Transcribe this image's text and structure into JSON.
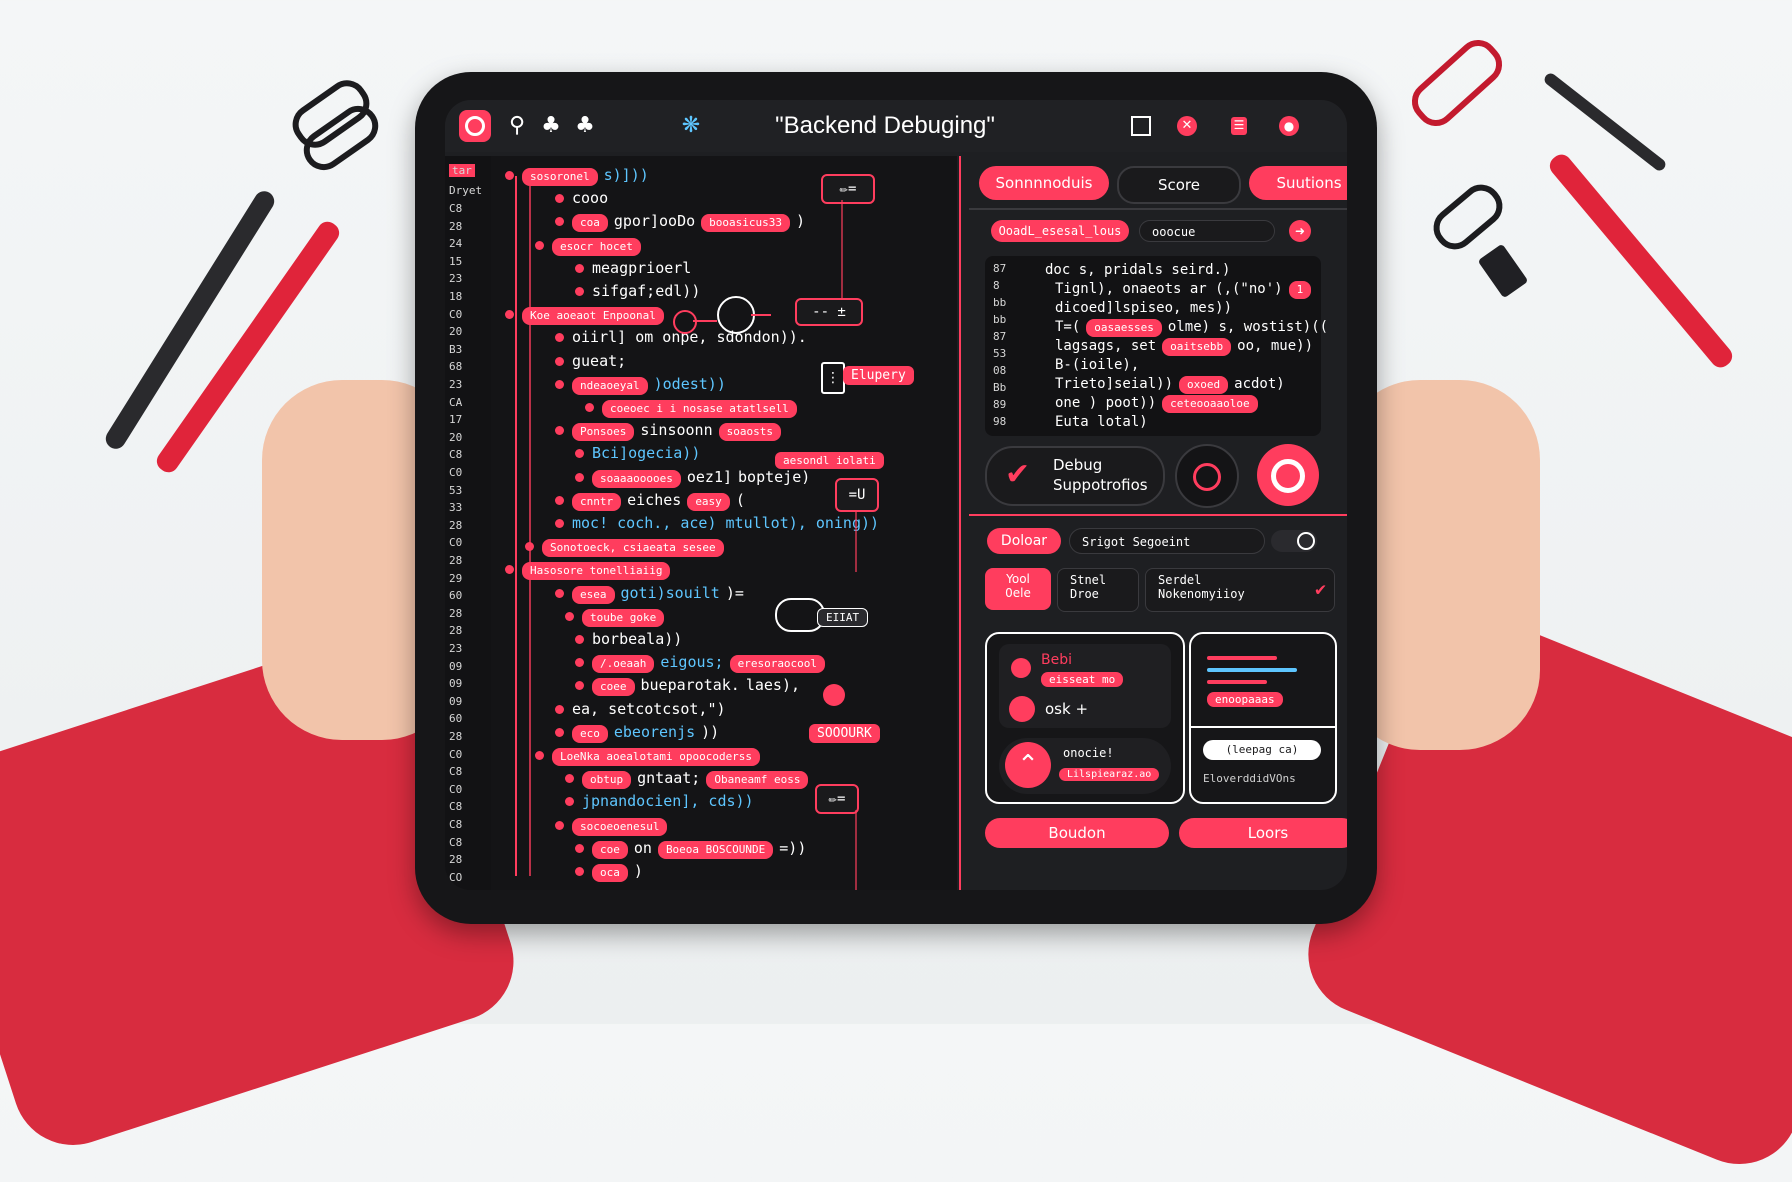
{
  "window": {
    "title": "\"Backend Debuging\""
  },
  "topbar": {
    "icons": [
      "record-icon",
      "search-icon",
      "club-icon",
      "plugin-icon",
      "bug-icon",
      "square-icon",
      "close-circle-icon",
      "menu-icon",
      "location-icon"
    ]
  },
  "code": {
    "gutter_header": [
      "tar",
      "Dryet"
    ],
    "gutter_numbers": [
      "C8",
      "28",
      "24",
      "15",
      "23",
      "18",
      "C0",
      "20",
      "B3",
      "68",
      "23",
      "CA",
      "17",
      "20",
      "C8",
      "C0",
      "53",
      "33",
      "28",
      "C0",
      "28",
      "29",
      "60",
      "28",
      "28",
      "23",
      "09",
      "09",
      "09",
      "60",
      "28",
      "C0",
      "C8",
      "C0",
      "C8",
      "C8",
      "C8",
      "28",
      "CO"
    ],
    "lines": [
      {
        "pill": "sosoronel",
        "text": "s)]))"
      },
      {
        "text": "cooo"
      },
      {
        "pill": "coa",
        "text": "gpor]ooDo",
        "pill2": "booasicus33",
        "tail": ")"
      },
      {
        "pill": "esocr hocet"
      },
      {
        "text": "meagprioerl"
      },
      {
        "text": "sifgaf;edl))"
      },
      {
        "pill": "Koe aoeaot Enpoonal"
      },
      {
        "text": "oiirl] om onpe, sdondon))."
      },
      {
        "text": "gueat;"
      },
      {
        "pill": "ndeaoeyal",
        "text": ")odest))"
      },
      {
        "pill": "coeoec i i nosase atatlsell"
      },
      {
        "pill": "Ponsoes",
        "text": "sinsoonn",
        "pill2": "soaosts"
      },
      {
        "text": "Bci]ogecia))"
      },
      {
        "text": "oez1]",
        "pill": "soaaaooooes",
        "tail": "bopteje)"
      },
      {
        "pill": "cnntr",
        "text": "eiches",
        "pill2": "easy",
        "tail": "("
      },
      {
        "text": "moc! coch., ace) mtullot), oning))"
      },
      {
        "pill": "Sonotoeck, csiaeata sesee"
      },
      {
        "pill": "Hasosore tonelliaiig"
      },
      {
        "text": "goti)souilt",
        "pill": "esea",
        "tail": ")="
      },
      {
        "pill": "toube goke"
      },
      {
        "text": "borbeala))"
      },
      {
        "pill": "/.oeaah",
        "text": "eigous;",
        "pill2": "eresoraocool"
      },
      {
        "text": "bueparotak.",
        "pill": "coee",
        "tail": "laes),"
      },
      {
        "text": "ea, setcotcsot,\")"
      },
      {
        "text": "ebeorenjs",
        "pill": "eco",
        "tail": "))"
      },
      {
        "pill": "LoeNka aoealotami opoocoderss"
      },
      {
        "pill": "obtup",
        "text": "gntaat;",
        "pill2": "Obaneamf eoss"
      },
      {
        "text": "jpnandocien], cds))"
      },
      {
        "pill": "socoeoenesul"
      },
      {
        "pill": "coe",
        "text": "on",
        "pill2": "Boeoa BOSCOUNDE",
        "tail": "=))"
      },
      {
        "pill": "oca",
        "tail": ")"
      }
    ],
    "side_tags": {
      "tag1": "Elupery",
      "tag2": "aesondl iolati",
      "tag3": "EIIAT",
      "tag4": "SOOOURK"
    },
    "side_boxes": [
      "edit-icon",
      "minus-plus-icon",
      "equals-u-icon",
      "edit-icon-2"
    ]
  },
  "right": {
    "tabs": [
      "Sonnnnoduis",
      "Score",
      "Suutions"
    ],
    "search": {
      "tag": "OoadL_esesal_lous",
      "placeholder": "ooocue"
    },
    "code_gutter": [
      "87",
      "8",
      "bb",
      "bb",
      "87",
      "53",
      "08",
      "Bb",
      "89",
      "98"
    ],
    "code_lines": [
      {
        "text": "doc s, pridals seird.)"
      },
      {
        "text": "Tignl), onaeots ar (,(\"no')",
        "pill": "1"
      },
      {
        "text": "dicoed]lspiseo, mes))"
      },
      {
        "text": "T=(",
        "pill": "oasaesses",
        "tail": "olme) s, wostist)(("
      },
      {
        "text": "lagsags, set",
        "pill": "oaitsebb",
        "tail": "oo, mue))"
      },
      {
        "text": "B-(ioile),"
      },
      {
        "text": "Trieto]seial))",
        "pill": "oxoed",
        "tail": "acdot)"
      },
      {
        "pill": "ceteooaaoloe",
        "text": "one ) poot))"
      },
      {
        "text": "Euta lotal)"
      }
    ],
    "debug_card": {
      "line1": "Debug",
      "line2": "Suppotrofios"
    },
    "filter": {
      "tag": "Doloar",
      "placeholder": "Srigot Segoeint"
    },
    "row": {
      "badge_line1": "Yool",
      "badge_line2": "0ele",
      "box1_line1": "Stnel",
      "box1_line2": "Droe",
      "box2_line1": "Serdel",
      "box2_line2": "Nokenomyiioy"
    },
    "card_left": {
      "title": "Bebi",
      "pill": "eisseat mo",
      "label": "osk +",
      "inner_label": "onocie!",
      "inner_pill": "Lilspiearaz.ao"
    },
    "card_right": {
      "pill": "enoopaaas",
      "input": "(leepag ca)",
      "caption": "EloverddidVOns"
    },
    "buttons": {
      "left": "Boudon",
      "right": "Loors"
    }
  }
}
